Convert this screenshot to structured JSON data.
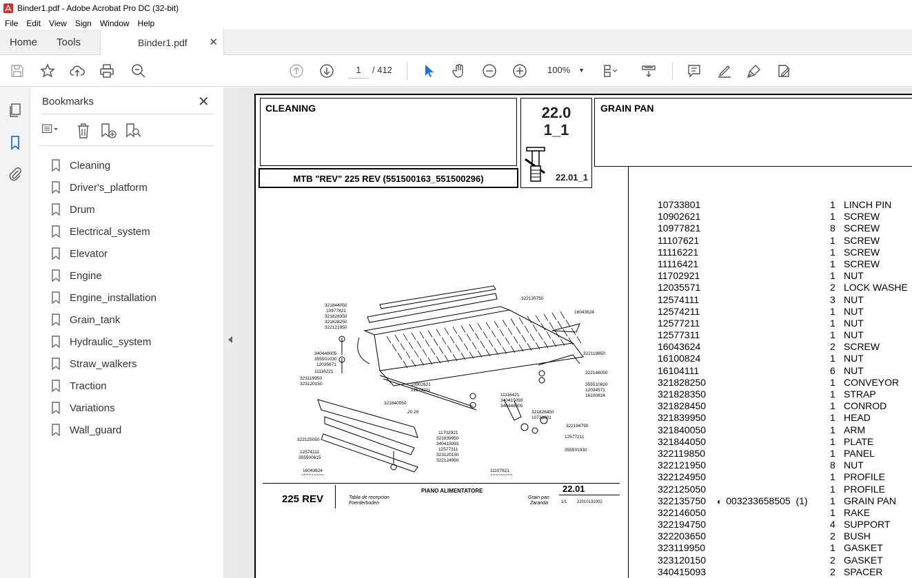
{
  "window": {
    "title": "Binder1.pdf - Adobe Acrobat Pro DC (32-bit)"
  },
  "menu": [
    "File",
    "Edit",
    "View",
    "Sign",
    "Window",
    "Help"
  ],
  "tabs": {
    "home": "Home",
    "tools": "Tools",
    "document": "Binder1.pdf"
  },
  "toolbar": {
    "current_page": "1",
    "page_total": "/ 412",
    "zoom": "100%"
  },
  "bookmarks": {
    "title": "Bookmarks",
    "items": [
      "Cleaning",
      "Driver's_platform",
      "Drum",
      "Electrical_system",
      "Elevator",
      "Engine",
      "Engine_installation",
      "Grain_tank",
      "Hydraulic_system",
      "Straw_walkers",
      "Traction",
      "Variations",
      "Wall_guard"
    ]
  },
  "doc": {
    "section": "CLEANING",
    "code_top": "22.0",
    "code_bottom": "1_1",
    "group": "GRAIN PAN",
    "model": "MTB \"REV\" 225 REV (551500163_551500296)",
    "figure_ref": "22.01_1",
    "footer_model": "225 REV",
    "footer_title": "PIANO ALIMENTATORE",
    "footer_sub1": "Tabla de recepcion",
    "footer_sub2": "Foerderboden",
    "footer_right1": "Grain pan",
    "footer_right2": "Zaranda",
    "footer_code": "22.01",
    "footer_sheet": "1/1",
    "footer_number": "22010131002",
    "dimension": "20.29",
    "callouts": [
      "321844050",
      "10977821",
      "321828350",
      "321828250",
      "322121950",
      "340448005",
      "355501030",
      "12035671",
      "11116221",
      "323119950",
      "323120150",
      "322135750",
      "16043624",
      "322119850",
      "322146050",
      "355510820",
      "12034571",
      "16100824",
      "10902621",
      "12574211",
      "11116421",
      "340415093",
      "340448005",
      "321840050",
      "321828450",
      "10733801",
      "322194790",
      "12577211",
      "355501930",
      "11702921",
      "321839950",
      "340415093",
      "12577311",
      "323120150",
      "322124950",
      "322125050",
      "12574111",
      "355500615",
      "16043624",
      "355510820",
      "16104111",
      "11107621",
      "322203650"
    ],
    "parts": [
      {
        "code": "10733801",
        "qty": "1",
        "desc": "LINCH PIN"
      },
      {
        "code": "10902621",
        "qty": "1",
        "desc": "SCREW"
      },
      {
        "code": "10977821",
        "qty": "8",
        "desc": "SCREW"
      },
      {
        "code": "11107621",
        "qty": "1",
        "desc": "SCREW"
      },
      {
        "code": "11116221",
        "qty": "1",
        "desc": "SCREW"
      },
      {
        "code": "11116421",
        "qty": "1",
        "desc": "SCREW"
      },
      {
        "code": "11702921",
        "qty": "1",
        "desc": "NUT"
      },
      {
        "code": "12035571",
        "qty": "2",
        "desc": "LOCK WASHE"
      },
      {
        "code": "12574111",
        "qty": "3",
        "desc": "NUT"
      },
      {
        "code": "12574211",
        "qty": "1",
        "desc": "NUT"
      },
      {
        "code": "12577211",
        "qty": "1",
        "desc": "NUT"
      },
      {
        "code": "12577311",
        "qty": "1",
        "desc": "NUT"
      },
      {
        "code": "16043624",
        "qty": "2",
        "desc": "SCREW"
      },
      {
        "code": "16100824",
        "qty": "1",
        "desc": "NUT"
      },
      {
        "code": "16104111",
        "qty": "6",
        "desc": "NUT"
      },
      {
        "code": "321828250",
        "qty": "1",
        "desc": "CONVEYOR"
      },
      {
        "code": "321828350",
        "qty": "1",
        "desc": "STRAP"
      },
      {
        "code": "321828450",
        "qty": "1",
        "desc": "CONROD"
      },
      {
        "code": "321839950",
        "qty": "1",
        "desc": "HEAD"
      },
      {
        "code": "321840050",
        "qty": "1",
        "desc": "ARM"
      },
      {
        "code": "321844050",
        "qty": "1",
        "desc": "PLATE"
      },
      {
        "code": "322119850",
        "qty": "1",
        "desc": "PANEL"
      },
      {
        "code": "322121950",
        "qty": "8",
        "desc": "NUT"
      },
      {
        "code": "322124950",
        "qty": "1",
        "desc": "PROFILE"
      },
      {
        "code": "322125050",
        "qty": "1",
        "desc": "PROFILE"
      },
      {
        "code": "322135750",
        "qty": "1",
        "desc": "GRAIN PAN",
        "note": "003233658505",
        "note_qty": "(1)"
      },
      {
        "code": "322146050",
        "qty": "1",
        "desc": "RAKE"
      },
      {
        "code": "322194750",
        "qty": "4",
        "desc": "SUPPORT"
      },
      {
        "code": "322203650",
        "qty": "2",
        "desc": "BUSH"
      },
      {
        "code": "323119950",
        "qty": "1",
        "desc": "GASKET"
      },
      {
        "code": "323120150",
        "qty": "2",
        "desc": "GASKET"
      },
      {
        "code": "340415093",
        "qty": "2",
        "desc": "SPACER"
      }
    ]
  },
  "colors": {
    "accent": "#1473e6",
    "toolbar_bg": "#ffffff",
    "tabbar_bg": "#f0f0f0",
    "panel_bg": "#f4f4f4",
    "doc_bg": "#e8e8e8"
  }
}
